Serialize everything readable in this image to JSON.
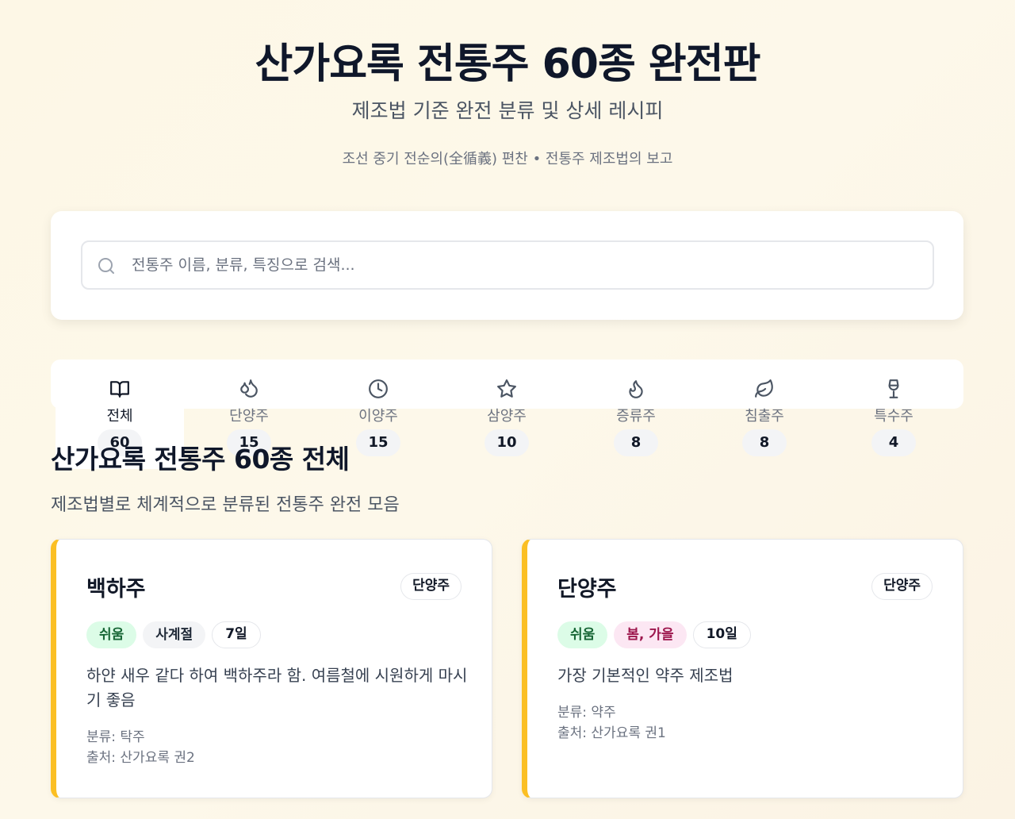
{
  "header": {
    "title": "산가요록 전통주 60종 완전판",
    "subtitle": "제조법 기준 완전 분류 및 상세 레시피",
    "source": "조선 중기 전순의(全循義) 편찬 • 전통주 제조법의 보고"
  },
  "search": {
    "placeholder": "전통주 이름, 분류, 특징으로 검색...",
    "value": ""
  },
  "tabs": [
    {
      "label": "전체",
      "count": "60",
      "icon": "book-open-icon",
      "active": true
    },
    {
      "label": "단양주",
      "count": "15",
      "icon": "droplets-icon",
      "active": false
    },
    {
      "label": "이양주",
      "count": "15",
      "icon": "clock-icon",
      "active": false
    },
    {
      "label": "삼양주",
      "count": "10",
      "icon": "star-icon",
      "active": false
    },
    {
      "label": "증류주",
      "count": "8",
      "icon": "flame-icon",
      "active": false
    },
    {
      "label": "침출주",
      "count": "8",
      "icon": "leaf-icon",
      "active": false
    },
    {
      "label": "특수주",
      "count": "4",
      "icon": "wine-glass-icon",
      "active": false
    }
  ],
  "section": {
    "title": "산가요록 전통주 60종 전체",
    "description": "제조법별로 체계적으로 분류된 전통주 완전 모음"
  },
  "cards": [
    {
      "name": "백하주",
      "category": "단양주",
      "difficulty": "쉬움",
      "season": "사계절",
      "duration": "7일",
      "description": "하얀 새우 같다 하여 백하주라 함. 여름철에 시원하게 마시기 좋음",
      "type_line": "분류: 탁주",
      "source_line": "출처: 산가요록 권2"
    },
    {
      "name": "단양주",
      "category": "단양주",
      "difficulty": "쉬움",
      "season": "봄, 가을",
      "duration": "10일",
      "description": "가장 기본적인 약주 제조법",
      "type_line": "분류: 약주",
      "source_line": "출처: 산가요록 권1"
    }
  ],
  "colors": {
    "accent": "#fbbf24",
    "easy_bg": "#dcfce7",
    "easy_text": "#166534",
    "pink_bg": "#fce7f3",
    "pink_text": "#9d174d"
  }
}
